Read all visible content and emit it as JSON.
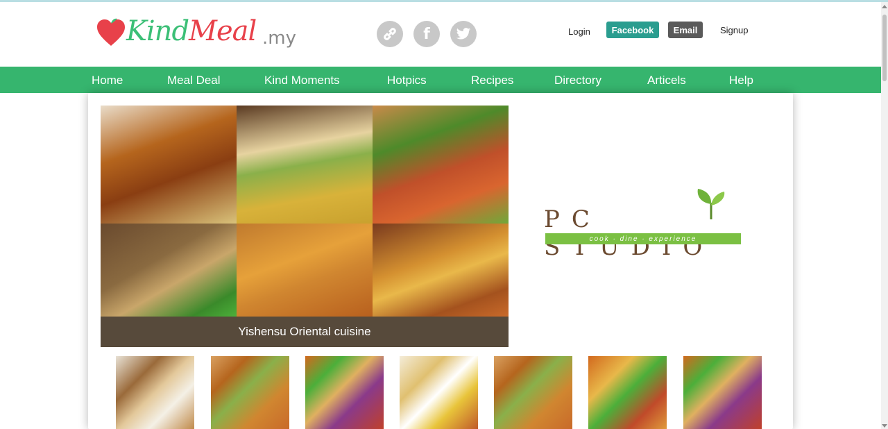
{
  "brand": {
    "name_part1": "Kind",
    "name_part2": "Meal",
    "suffix": ".my"
  },
  "social_icons": [
    {
      "name": "link-icon",
      "glyph": "🔗"
    },
    {
      "name": "facebook-icon",
      "glyph": "f"
    },
    {
      "name": "twitter-icon",
      "glyph": "🐦"
    }
  ],
  "account": {
    "login": "Login",
    "facebook": "Facebook",
    "email": "Email",
    "signup": "Signup"
  },
  "nav": {
    "items": [
      "Home",
      "Meal Deal",
      "Kind Moments",
      "Hotpics",
      "Recipes",
      "Directory",
      "Articels",
      "Help"
    ]
  },
  "featured": {
    "caption": "Yishensu Oriental cuisine"
  },
  "sponsor": {
    "letters": "PC STUDIO",
    "tagline": "cook · dine · experience"
  },
  "colors": {
    "brand_green": "#36b56e",
    "facebook_button": "#2a9d8f",
    "email_button": "#5a5a5a",
    "caption_bg": "#574a3b"
  }
}
